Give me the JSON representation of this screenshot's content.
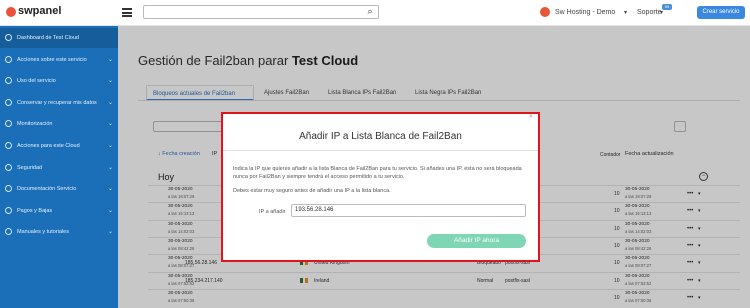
{
  "topbar": {
    "logo_text": "swpanel",
    "search_placeholder": "",
    "account_name": "Sw Hosting - Demo",
    "support_label": "Soporte",
    "support_badge": "99",
    "create_button": "Crear servicio"
  },
  "sidebar": {
    "items": [
      {
        "label": "Dashboard de Test Cloud",
        "has_chevron": false
      },
      {
        "label": "Acciones sobre este servicio",
        "has_chevron": true
      },
      {
        "label": "Uso del servicio",
        "has_chevron": true
      },
      {
        "label": "Conservar y recuperar mis datos",
        "has_chevron": true
      },
      {
        "label": "Monitorización",
        "has_chevron": true
      },
      {
        "label": "Acciones para este Cloud",
        "has_chevron": true
      },
      {
        "label": "Seguridad",
        "has_chevron": true
      },
      {
        "label": "Documentación Servicio",
        "has_chevron": true
      },
      {
        "label": "Pagos y Bajas",
        "has_chevron": true
      },
      {
        "label": "Manuales y tutoriales",
        "has_chevron": true
      }
    ]
  },
  "main": {
    "title_prefix": "Gestión de Fail2ban parar ",
    "title_bold": "Test Cloud",
    "tabs": [
      {
        "label": "Bloqueos actuales de Fail2ban",
        "active": true
      },
      {
        "label": "Ajustes Fail2Ban",
        "active": false
      },
      {
        "label": "Lista Blanca IPs Fail2Ban",
        "active": false
      },
      {
        "label": "Lista Negra IPs Fail2Ban",
        "active": false
      }
    ],
    "columns": {
      "fecha": "Fecha creación",
      "ip": "IP",
      "contador": "Contador",
      "fecha_actualizacion": "Fecha actualización"
    },
    "group_label": "Hoy",
    "rows": [
      {
        "date": "30-05-2020",
        "time": "a las 18:07:29",
        "ip": "",
        "country": "",
        "mode": "",
        "service": "",
        "count": "10",
        "udate": "30-05-2020",
        "utime": "a las 18:07:29"
      },
      {
        "date": "30-05-2020",
        "time": "a las 15:13:13",
        "ip": "",
        "country": "",
        "mode": "",
        "service": "",
        "count": "10",
        "udate": "30-05-2020",
        "utime": "a las 15:13:13"
      },
      {
        "date": "30-05-2020",
        "time": "a las 14:02:03",
        "ip": "",
        "country": "",
        "mode": "",
        "service": "",
        "count": "10",
        "udate": "30-05-2020",
        "utime": "a las 14:02:03"
      },
      {
        "date": "30-05-2020",
        "time": "a las 08:42:26",
        "ip": "",
        "country": "",
        "mode": "",
        "service": "",
        "count": "10",
        "udate": "30-05-2020",
        "utime": "a las 08:42:26"
      },
      {
        "date": "30-05-2020",
        "time": "a las 08:07:27",
        "ip": "185.56.28.146",
        "country": "United Kingdom",
        "mode": "Bloqueado",
        "service": "postfix-sasl",
        "count": "10",
        "udate": "30-05-2020",
        "utime": "a las 08:07:27"
      },
      {
        "date": "30-05-2020",
        "time": "a las 07:53:52",
        "ip": "185.234.217.140",
        "country": "Ireland",
        "mode": "Normal",
        "service": "postfix-sasl",
        "count": "10",
        "udate": "30-05-2020",
        "utime": "a las 07:53:52"
      },
      {
        "date": "30-05-2020",
        "time": "a las 07:50:36",
        "ip": "",
        "country": "",
        "mode": "",
        "service": "",
        "count": "10",
        "udate": "30-05-2020",
        "utime": "a las 07:50:36"
      }
    ]
  },
  "modal": {
    "title": "Añadir IP a Lista Blanca de Fail2Ban",
    "close": "×",
    "description": "Indica la IP que quieres añadir a la lista Blanca de Fail2Ban para tu servicio. Si añades una IP, ésta no será bloqueada nunca por Fail2Ban y siempre tendrá el acceso permitido a tu servicio.",
    "confirm_text": "Debes estar muy seguro antes de añadir una IP a la lista blanca.",
    "ip_label": "IP a añadir",
    "ip_value": "193.56.28.146",
    "submit_label": "Añadir IP ahora"
  }
}
